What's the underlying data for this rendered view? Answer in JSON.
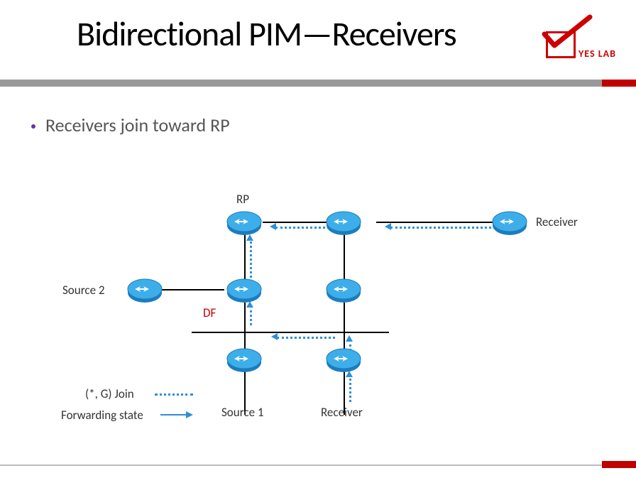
{
  "title": "Bidirectional PIM—Receivers",
  "brand": "YES LAB",
  "bullet": "Receivers join toward RP",
  "labels": {
    "rp": "RP",
    "receiver_right": "Receiver",
    "source2": "Source 2",
    "df": "DF",
    "join": "(*, G) Join",
    "forwarding": "Forwarding state",
    "source1": "Source 1",
    "receiver_bottom": "Receiver"
  }
}
